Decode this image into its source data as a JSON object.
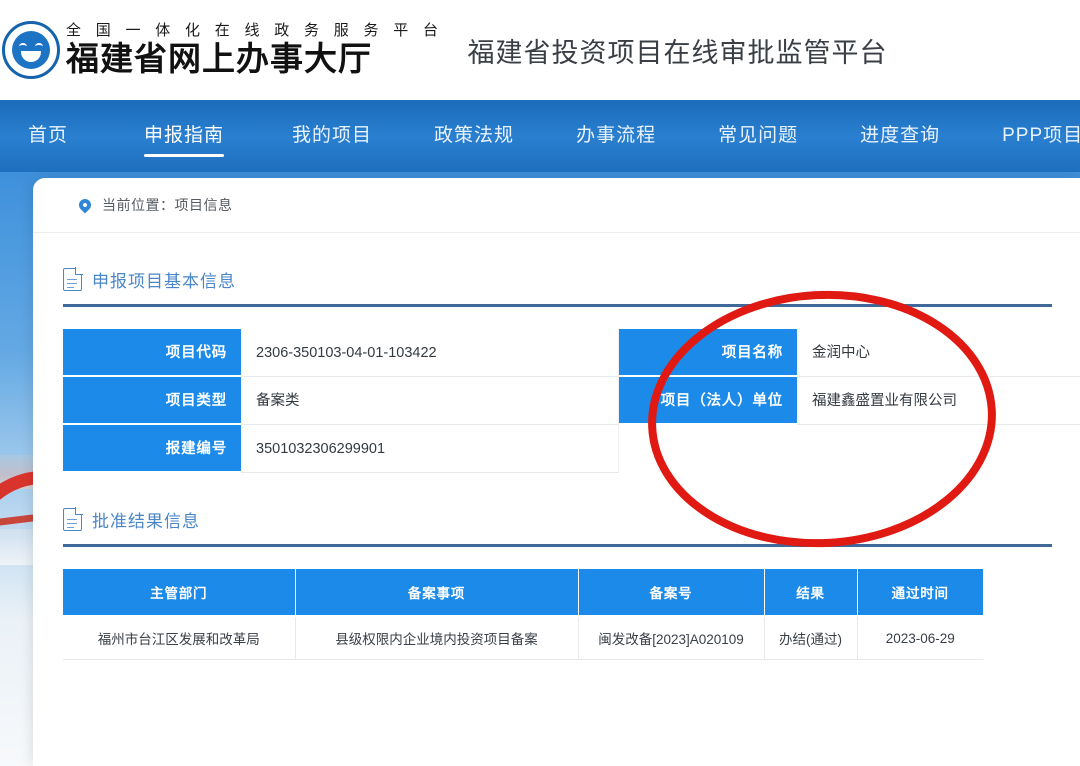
{
  "header": {
    "emblem_icon": "smiley-government-emblem",
    "logo_small": "全 国 一 体 化 在 线 政 务 服 务 平 台",
    "logo_big": "福建省网上办事大厅",
    "platform_title": "福建省投资项目在线审批监管平台"
  },
  "nav": {
    "items": [
      {
        "label": "首页",
        "active": false
      },
      {
        "label": "申报指南",
        "active": true
      },
      {
        "label": "我的项目",
        "active": false
      },
      {
        "label": "政策法规",
        "active": false
      },
      {
        "label": "办事流程",
        "active": false
      },
      {
        "label": "常见问题",
        "active": false
      },
      {
        "label": "进度查询",
        "active": false
      },
      {
        "label": "PPP项目申报",
        "active": false
      }
    ]
  },
  "breadcrumb": {
    "icon": "location-pin-icon",
    "text": "当前位置：项目信息"
  },
  "basic_info": {
    "icon": "document-icon",
    "title": "申报项目基本信息",
    "fields": {
      "project_code_label": "项目代码",
      "project_code_value": "2306-350103-04-01-103422",
      "project_name_label": "项目名称",
      "project_name_value": "金润中心",
      "project_type_label": "项目类型",
      "project_type_value": "备案类",
      "legal_entity_label": "项目（法人）单位",
      "legal_entity_value": "福建鑫盛置业有限公司",
      "build_number_label": "报建编号",
      "build_number_value": "3501032306299901"
    }
  },
  "approval_result": {
    "icon": "document-icon",
    "title": "批准结果信息",
    "columns": [
      "主管部门",
      "备案事项",
      "备案号",
      "结果",
      "通过时间"
    ],
    "rows": [
      {
        "department": "福州市台江区发展和改革局",
        "item": "县级权限内企业境内投资项目备案",
        "record_no": "闽发改备[2023]A020109",
        "result": "办结(通过)",
        "pass_time": "2023-06-29"
      }
    ]
  },
  "annotation": {
    "shape": "red-ellipse-highlight",
    "color": "#E01A12"
  },
  "colors": {
    "nav_blue": "#2a7fd0",
    "label_blue": "#1b8ae8",
    "section_title_blue": "#4a86c8",
    "rule_blue": "#40699b",
    "annotation_red": "#E01A12"
  }
}
